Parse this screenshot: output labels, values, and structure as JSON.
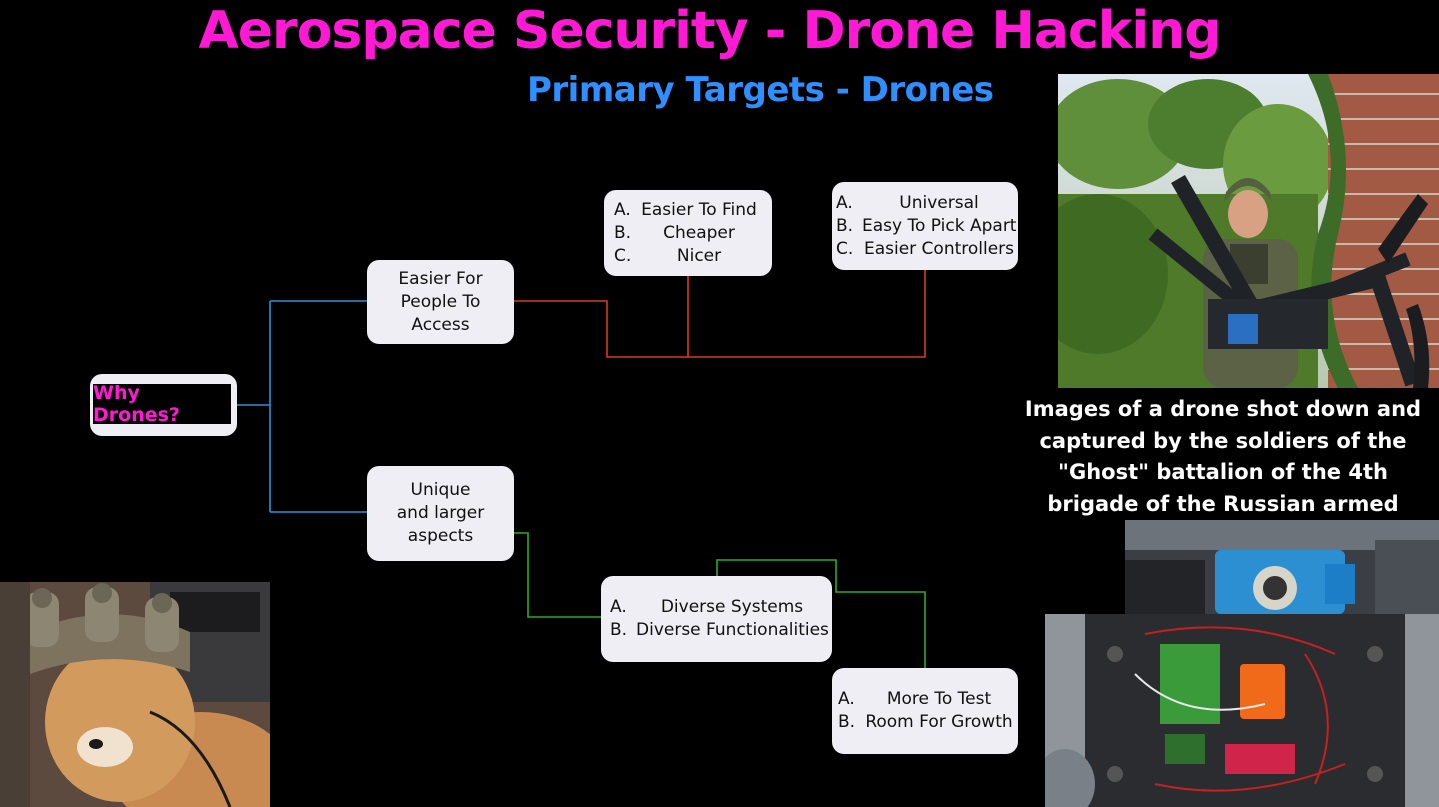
{
  "header": {
    "title": "Aerospace Security - Drone Hacking",
    "subtitle": "Primary Targets - Drones"
  },
  "diagram": {
    "root": "Why Drones?",
    "branch_access": [
      "Easier For",
      "People To",
      "Access"
    ],
    "branch_unique": [
      "Unique",
      "and larger",
      "aspects"
    ],
    "access_list_1": [
      {
        "marker": "A.",
        "text": "Easier To Find"
      },
      {
        "marker": "B.",
        "text": "Cheaper"
      },
      {
        "marker": "C.",
        "text": "Nicer"
      }
    ],
    "access_list_2": [
      {
        "marker": "A.",
        "text": "Universal"
      },
      {
        "marker": "B.",
        "text": "Easy To Pick Apart"
      },
      {
        "marker": "C.",
        "text": "Easier Controllers"
      }
    ],
    "unique_list_1": [
      {
        "marker": "A.",
        "text": "Diverse Systems"
      },
      {
        "marker": "B.",
        "text": "Diverse Functionalities"
      }
    ],
    "unique_list_2": [
      {
        "marker": "A.",
        "text": "More To Test"
      },
      {
        "marker": "B.",
        "text": "Room For Growth"
      }
    ],
    "colors": {
      "blue_connector": "#2f8fd8",
      "red_connector": "#d83a22",
      "green_connector": "#2ea82e"
    }
  },
  "caption": "Images of a drone shot down and captured by the soldiers of the \"Ghost\" battalion of the 4th brigade of the Russian armed forces"
}
